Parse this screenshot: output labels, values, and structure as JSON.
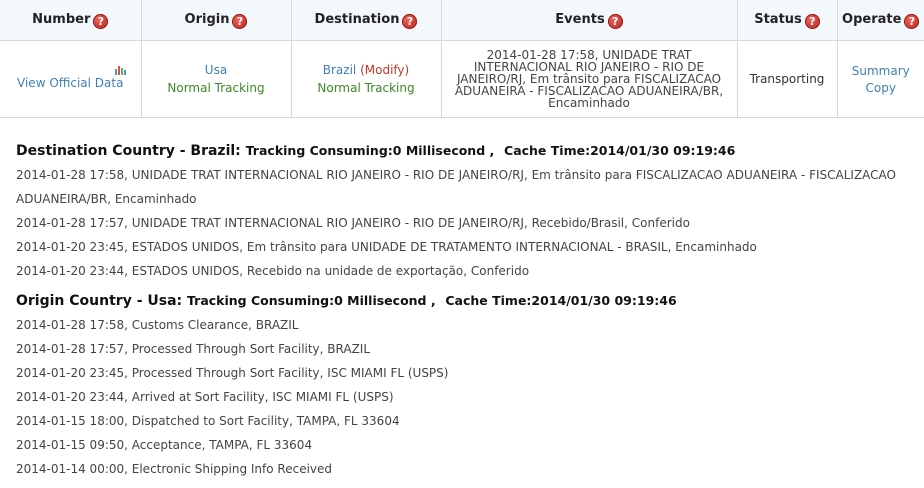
{
  "table": {
    "headers": {
      "number": "Number",
      "origin": "Origin",
      "destination": "Destination",
      "events": "Events",
      "status": "Status",
      "operate": "Operate"
    },
    "help_icon_glyph": "?",
    "row": {
      "view_official": "View Official Data",
      "origin_country": "Usa",
      "origin_tracking": "Normal Tracking",
      "dest_country": "Brazil",
      "dest_modify": "(Modify)",
      "dest_tracking": "Normal Tracking",
      "event": "2014-01-28 17:58, UNIDADE TRAT INTERNACIONAL RIO JANEIRO - RIO DE JANEIRO/RJ, Em trânsito para FISCALIZACAO ADUANEIRA - FISCALIZACAO ADUANEIRA/BR, Encaminhado",
      "status": "Transporting",
      "summary": "Summary",
      "copy": "Copy"
    }
  },
  "destination_section": {
    "title": "Destination Country - Brazil:",
    "consuming": "Tracking Consuming:0 Millisecond ,",
    "cache": "Cache Time:2014/01/30 09:19:46",
    "events": [
      "2014-01-28 17:58, UNIDADE TRAT INTERNACIONAL RIO JANEIRO - RIO DE JANEIRO/RJ, Em trânsito para FISCALIZACAO ADUANEIRA - FISCALIZACAO ADUANEIRA/BR, Encaminhado",
      "2014-01-28 17:57, UNIDADE TRAT INTERNACIONAL RIO JANEIRO - RIO DE JANEIRO/RJ, Recebido/Brasil, Conferido",
      "2014-01-20 23:45, ESTADOS UNIDOS, Em trânsito para UNIDADE DE TRATAMENTO INTERNACIONAL - BRASIL, Encaminhado",
      "2014-01-20 23:44, ESTADOS UNIDOS, Recebido na unidade de exportação, Conferido"
    ]
  },
  "origin_section": {
    "title": "Origin Country - Usa:",
    "consuming": "Tracking Consuming:0 Millisecond ,",
    "cache": "Cache Time:2014/01/30 09:19:46",
    "events": [
      "2014-01-28 17:58, Customs Clearance, BRAZIL",
      "2014-01-28 17:57, Processed Through Sort Facility, BRAZIL",
      "2014-01-20 23:45, Processed Through Sort Facility, ISC MIAMI FL (USPS)",
      "2014-01-20 23:44, Arrived at Sort Facility, ISC MIAMI FL (USPS)",
      "2014-01-15 18:00, Dispatched to Sort Facility, TAMPA, FL 33604",
      "2014-01-15 09:50, Acceptance, TAMPA, FL 33604",
      "2014-01-14 00:00, Electronic Shipping Info Received"
    ]
  },
  "icons": {
    "help": "question-mark-icon",
    "chart": "bar-chart-icon"
  },
  "colors": {
    "link": "#3f7fb8",
    "normal_tracking": "#3a8a23",
    "modify": "#c0392b",
    "help_icon": "#c62e25",
    "header_bg": "#f3f8fc",
    "border": "#cfdbe4"
  }
}
